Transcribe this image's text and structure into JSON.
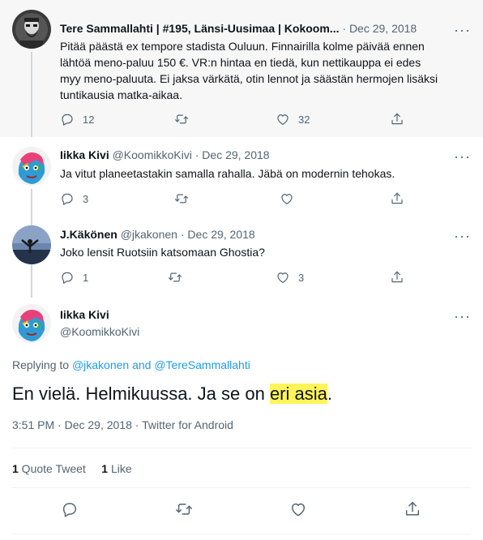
{
  "tweets": [
    {
      "name": "Tere Sammallahti | #195, Länsi-Uusimaa | Kokoom...",
      "dot": "·",
      "date": "Dec 29, 2018",
      "more": "···",
      "lines": [
        "Pitää päästä ex tempore stadista Ouluun. Finnairilla kolme päivää ennen",
        "lähtöä meno-paluu 150 €. VR:n hintaa en tiedä, kun nettikauppa ei edes",
        "myy meno-paluuta. Ei jaksa värkätä, otin lennot ja säästän hermojen lisäksi",
        "tuntikausia matka-aikaa."
      ],
      "replies": "12",
      "retweets": "",
      "likes": "32"
    },
    {
      "name": "Iikka Kivi",
      "handle": "@KoomikkoKivi",
      "dot": "·",
      "date": "Dec 29, 2018",
      "more": "···",
      "lines": [
        "Ja vitut planeetastakin samalla rahalla. Jäbä on modernin tehokas."
      ],
      "replies": "3",
      "retweets": "",
      "likes": ""
    },
    {
      "name": "J.Käkönen",
      "handle": "@jkakonen",
      "dot": "·",
      "date": "Dec 29, 2018",
      "more": "···",
      "lines": [
        "Joko lensit Ruotsiin katsomaan Ghostia?"
      ],
      "replies": "1",
      "retweets": "",
      "likes": "3"
    }
  ],
  "focus": {
    "name": "Iikka Kivi",
    "handle": "@KoomikkoKivi",
    "more": "···",
    "replying_prefix": "Replying to ",
    "replying_user1": "@jkakonen",
    "replying_and": " and ",
    "replying_user2": "@TereSammallahti",
    "text_before": "En vielä. Helmikuussa. Ja se on ",
    "text_highlight": "eri asia",
    "text_after": ".",
    "time": "3:51 PM",
    "dot1": " · ",
    "date": "Dec 29, 2018",
    "dot2": " · ",
    "source": "Twitter for Android",
    "quote_count": "1",
    "quote_label": " Quote Tweet",
    "like_count": "1",
    "like_label": " Like"
  },
  "icons": {
    "reply": "speech-bubble-icon",
    "retweet": "retweet-arrows-icon",
    "like": "heart-icon",
    "share": "share-upload-icon",
    "more": "ellipsis-icon"
  },
  "colors": {
    "link": "#1d9bf0",
    "highlight": "#fff55a",
    "secondary_text": "#536471",
    "thread_bg": "#f7f7f7"
  }
}
